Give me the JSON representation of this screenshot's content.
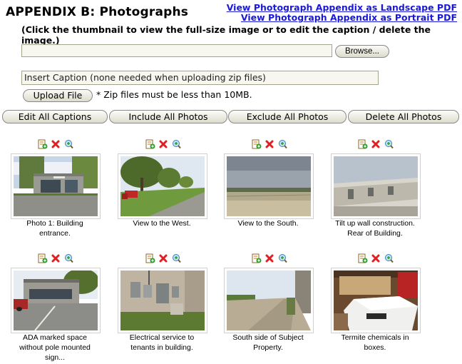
{
  "header": {
    "title": "APPENDIX B: Photographs",
    "landscape_pdf_link": "View Photograph Appendix as Landscape PDF",
    "portrait_pdf_link": "View Photograph Appendix as Portrait PDF",
    "instructions": "(Click the thumbnail to view the full-size image or to edit the caption / delete the image.)"
  },
  "upload": {
    "file_value": "",
    "browse_label": "Browse...",
    "caption_value": "Insert Caption (none needed when uploading zip files)",
    "upload_label": "Upload File",
    "note": "* Zip files must be less than 10MB."
  },
  "actions": {
    "edit_all": "Edit All Captions",
    "include_all": "Include All Photos",
    "exclude_all": "Exclude All Photos",
    "delete_all": "Delete All Photos"
  },
  "photo_icons": [
    "include-icon",
    "delete-icon",
    "zoom-icon"
  ],
  "photos": [
    {
      "caption_line1": "Photo 1: Building",
      "caption_line2": "entrance.",
      "caption_line3": ""
    },
    {
      "caption_line1": "View to the West.",
      "caption_line2": "",
      "caption_line3": ""
    },
    {
      "caption_line1": "View to the South.",
      "caption_line2": "",
      "caption_line3": ""
    },
    {
      "caption_line1": "Tilt up wall construction.",
      "caption_line2": "Rear of Building.",
      "caption_line3": ""
    },
    {
      "caption_line1": "ADA marked space",
      "caption_line2": "without pole mounted",
      "caption_line3": "sign..."
    },
    {
      "caption_line1": "Electrical service to",
      "caption_line2": "tenants in building.",
      "caption_line3": ""
    },
    {
      "caption_line1": "South side of Subject",
      "caption_line2": "Property.",
      "caption_line3": ""
    },
    {
      "caption_line1": "Termite chemicals in",
      "caption_line2": "boxes.",
      "caption_line3": ""
    }
  ],
  "colors": {
    "link": "#1a1ad6",
    "input_bg": "#f7f7ef",
    "delete": "#e02020"
  }
}
